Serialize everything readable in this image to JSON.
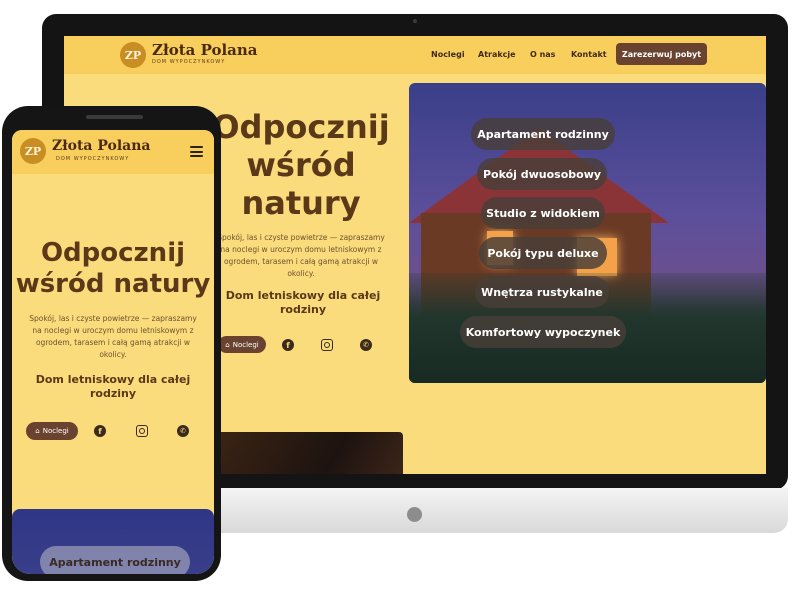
{
  "brand": {
    "monogram": "ZP",
    "name": "Złota Polana",
    "tagline": "DOM WYPOCZYNKOWY"
  },
  "nav": {
    "items": [
      "Noclegi",
      "Atrakcje",
      "O nas",
      "Kontakt"
    ],
    "cta": "Zarezerwuj pobyt"
  },
  "hero": {
    "title_line1": "Odpocznij",
    "title_line2": "wśród",
    "title_line3": "natury",
    "mobile_title_line1": "Odpocznij",
    "mobile_title_line2": "wśród natury",
    "description": "Spokój, las i czyste powietrze — zapraszamy na noclegi w uroczym domu letniskowym z ogrodem, tarasem i całą gamą atrakcji w okolicy.",
    "subtitle": "Dom letniskowy dla całej rodziny",
    "button_label": "Noclegi"
  },
  "rooms": [
    "Apartament rodzinny",
    "Pokój dwuosobowy",
    "Studio z widokiem",
    "Pokój typu deluxe",
    "Wnętrza rustykalne",
    "Komfortowy wypoczynek"
  ],
  "social": [
    "facebook-icon",
    "instagram-icon",
    "whatsapp-icon"
  ],
  "colors": {
    "background": "#fbdc7c",
    "header": "#f8cf5c",
    "accent": "#6a4330",
    "text": "#5a3818"
  }
}
